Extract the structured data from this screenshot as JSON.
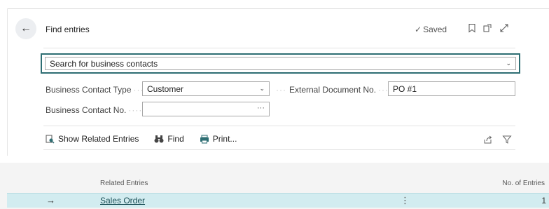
{
  "header": {
    "back_icon": "arrow-left-icon",
    "title": "Find entries",
    "saved_label": "Saved",
    "icons": [
      "bookmark-icon",
      "open-new-window-icon",
      "expand-icon"
    ]
  },
  "search": {
    "value": "Search for business contacts"
  },
  "form": {
    "business_contact_type_label": "Business Contact Type",
    "business_contact_type_value": "Customer",
    "external_doc_label": "External Document No.",
    "external_doc_value": "PO #1",
    "business_contact_no_label": "Business Contact No.",
    "business_contact_no_value": ""
  },
  "actions": {
    "show_related": "Show Related Entries",
    "find": "Find",
    "print": "Print..."
  },
  "table": {
    "columns": [
      "Related Entries",
      "No. of Entries"
    ],
    "rows": [
      {
        "name": "Sales Order",
        "count": "1"
      }
    ]
  },
  "colors": {
    "accent": "#2e6e73",
    "selected_row": "#d2ecf0"
  }
}
